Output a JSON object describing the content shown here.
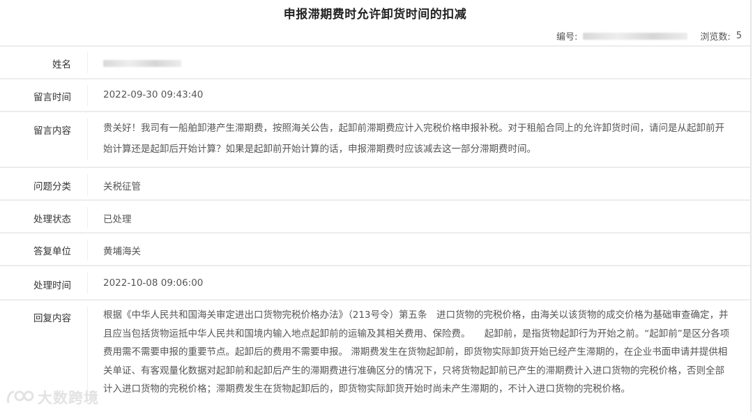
{
  "page": {
    "title": "申报滞期费时允许卸货时间的扣减",
    "id_label": "编号:",
    "views_label": "浏览数:",
    "views_count": "5"
  },
  "fields": [
    {
      "label": "姓名",
      "value": ""
    },
    {
      "label": "留言时间",
      "value": "2022-09-30 09:43:40"
    },
    {
      "label": "留言内容",
      "value": "贵关好！我司有一船舶卸港产生滞期费，按照海关公告，起卸前滞期费应计入完税价格申报补税。对于租船合同上的允许卸货时间，请问是从起卸前开始计算还是起卸后开始计算？如果是起卸前开始计算的话，申报滞期费时应该减去这一部分滞期费时间。"
    },
    {
      "label": "问题分类",
      "value": "关税征管"
    },
    {
      "label": "处理状态",
      "value": "已处理"
    },
    {
      "label": "答复单位",
      "value": "黄埔海关"
    },
    {
      "label": "处理时间",
      "value": "2022-10-08 09:06:00"
    },
    {
      "label": "回复内容",
      "value": "根据《中华人民共和国海关审定进出口货物完税价格办法》（213号令）第五条　进口货物的完税价格，由海关以该货物的成交价格为基础审查确定，并且应当包括货物运抵中华人民共和国境内输入地点起卸前的运输及其相关费用、保险费。　　起卸前，是指货物起卸行为开始之前。“起卸前”是区分各项费用需不需要申报的重要节点。起卸后的费用不需要申报。 滞期费发生在货物起卸前，即货物实际卸货开始已经产生滞期的，在企业书面申请并提供相关单证、有客观量化数据对起卸前和起卸后产生的滞期费进行准确区分的情况下，只将货物起卸前已产生的滞期费计入进口货物的完税价格，否则全部计入进口货物的完税价格；滞期费发生在货物起卸后的，即货物实际卸货开始时尚未产生滞期的，不计入进口货物的完税价格。"
    }
  ],
  "watermark": {
    "text": "大数跨境"
  }
}
